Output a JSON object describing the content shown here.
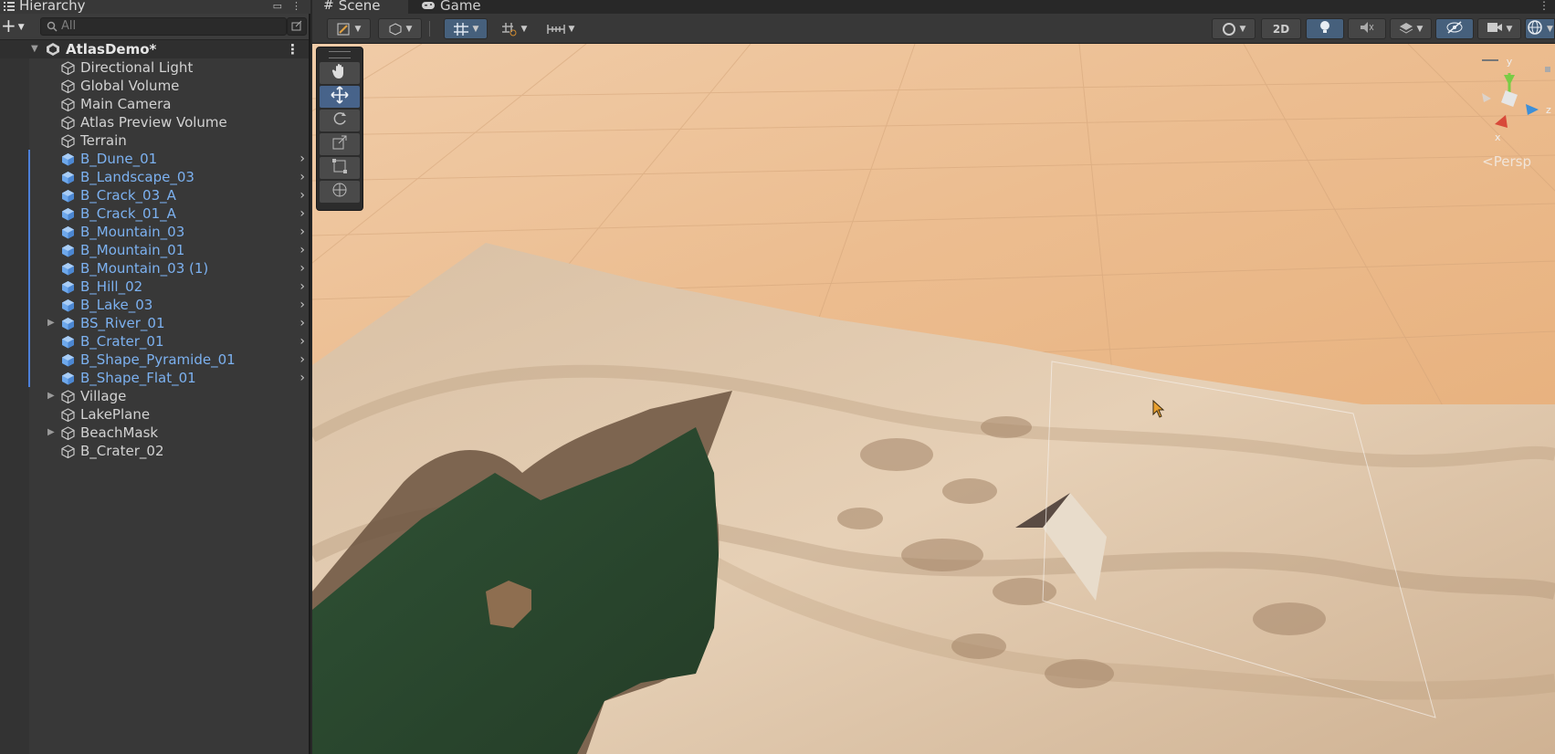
{
  "hierarchy": {
    "tab_title": "Hierarchy",
    "search_placeholder": "All",
    "scene_name": "AtlasDemo*",
    "items": [
      {
        "label": "Directional Light",
        "prefab": false,
        "foldout": false,
        "chevron": false
      },
      {
        "label": "Global Volume",
        "prefab": false,
        "foldout": false,
        "chevron": false
      },
      {
        "label": "Main Camera",
        "prefab": false,
        "foldout": false,
        "chevron": false
      },
      {
        "label": "Atlas Preview Volume",
        "prefab": false,
        "foldout": false,
        "chevron": false
      },
      {
        "label": "Terrain",
        "prefab": false,
        "foldout": false,
        "chevron": false
      },
      {
        "label": "B_Dune_01",
        "prefab": true,
        "foldout": false,
        "chevron": true
      },
      {
        "label": "B_Landscape_03",
        "prefab": true,
        "foldout": false,
        "chevron": true
      },
      {
        "label": "B_Crack_03_A",
        "prefab": true,
        "foldout": false,
        "chevron": true
      },
      {
        "label": "B_Crack_01_A",
        "prefab": true,
        "foldout": false,
        "chevron": true
      },
      {
        "label": "B_Mountain_03",
        "prefab": true,
        "foldout": false,
        "chevron": true
      },
      {
        "label": "B_Mountain_01",
        "prefab": true,
        "foldout": false,
        "chevron": true
      },
      {
        "label": "B_Mountain_03 (1)",
        "prefab": true,
        "foldout": false,
        "chevron": true
      },
      {
        "label": "B_Hill_02",
        "prefab": true,
        "foldout": false,
        "chevron": true
      },
      {
        "label": "B_Lake_03",
        "prefab": true,
        "foldout": false,
        "chevron": true
      },
      {
        "label": "BS_River_01",
        "prefab": true,
        "foldout": true,
        "chevron": true
      },
      {
        "label": "B_Crater_01",
        "prefab": true,
        "foldout": false,
        "chevron": true
      },
      {
        "label": "B_Shape_Pyramide_01",
        "prefab": true,
        "foldout": false,
        "chevron": true
      },
      {
        "label": "B_Shape_Flat_01",
        "prefab": true,
        "foldout": false,
        "chevron": true
      },
      {
        "label": "Village",
        "prefab": false,
        "foldout": true,
        "chevron": false
      },
      {
        "label": "LakePlane",
        "prefab": false,
        "foldout": false,
        "chevron": false
      },
      {
        "label": "BeachMask",
        "prefab": false,
        "foldout": true,
        "chevron": false
      },
      {
        "label": "B_Crater_02",
        "prefab": false,
        "foldout": false,
        "chevron": false
      }
    ]
  },
  "scene_view": {
    "tabs": {
      "scene": "Scene",
      "game": "Game"
    },
    "toggle_2d": "2D",
    "gizmo": {
      "y": "y",
      "z": "z",
      "x": "x",
      "projection": "Persp"
    },
    "icons": [
      "list-icon",
      "grid-icon",
      "gamepad-icon",
      "hand-icon",
      "move-icon",
      "rotate-icon",
      "scale-icon",
      "rect-icon",
      "transform-icon",
      "lightbulb-icon",
      "audio-mute-icon",
      "effects-icon",
      "hidden-icon",
      "camera-icon",
      "gizmo-icon"
    ]
  },
  "colors": {
    "prefab_text": "#7cb1f0",
    "selection_bar": "#4c7fd9",
    "toggle_on": "#46607c",
    "lake": "#2a4a2e"
  }
}
